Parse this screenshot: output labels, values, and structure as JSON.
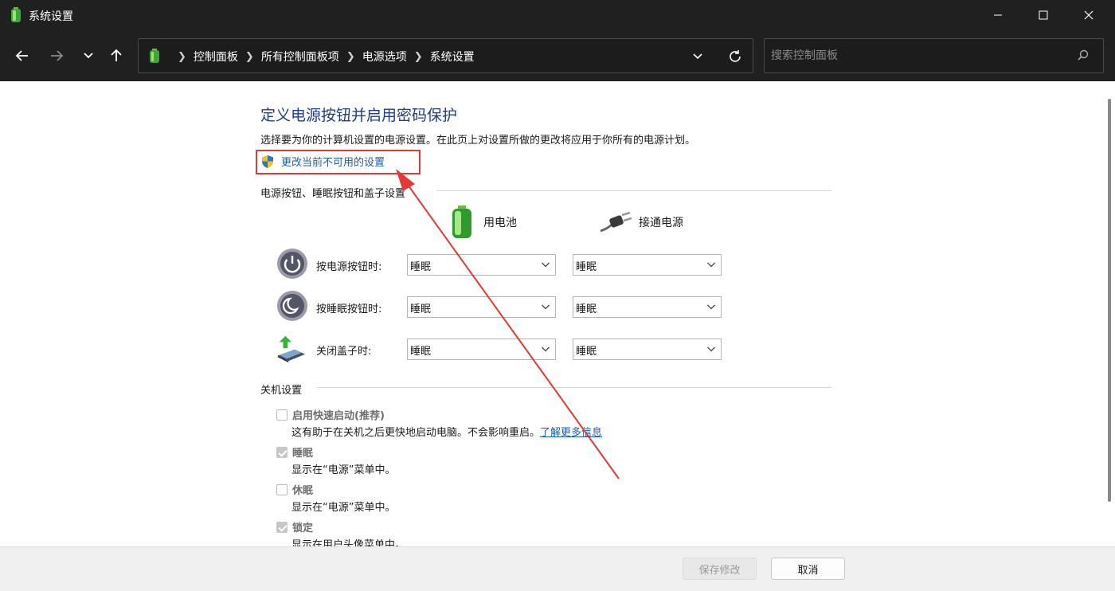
{
  "window": {
    "title": "系统设置"
  },
  "address": {
    "crumbs": [
      "控制面板",
      "所有控制面板项",
      "电源选项",
      "系统设置"
    ]
  },
  "search": {
    "placeholder": "搜索控制面板"
  },
  "page": {
    "heading": "定义电源按钮并启用密码保护",
    "description": "选择要为你的计算机设置的电源设置。在此页上对设置所做的更改将应用于你所有的电源计划。",
    "change_link": "更改当前不可用的设置"
  },
  "power_section": {
    "title": "电源按钮、睡眠按钮和盖子设置",
    "columns": [
      "用电池",
      "接通电源"
    ],
    "rows": [
      {
        "label": "按电源按钮时:",
        "icon": "power-button-icon",
        "battery": "睡眠",
        "plugged": "睡眠"
      },
      {
        "label": "按睡眠按钮时:",
        "icon": "sleep-button-icon",
        "battery": "睡眠",
        "plugged": "睡眠"
      },
      {
        "label": "关闭盖子时:",
        "icon": "laptop-lid-icon",
        "battery": "睡眠",
        "plugged": "睡眠"
      }
    ]
  },
  "shutdown_section": {
    "title": "关机设置",
    "items": [
      {
        "label": "启用快速启动(推荐)",
        "checked": false,
        "desc": "这有助于在关机之后更快地启动电脑。不会影响重启。",
        "link": "了解更多信息"
      },
      {
        "label": "睡眠",
        "checked": true,
        "desc": "显示在“电源”菜单中。"
      },
      {
        "label": "休眠",
        "checked": false,
        "desc": "显示在“电源”菜单中。"
      },
      {
        "label": "锁定",
        "checked": true,
        "desc": "显示在用户头像菜单中。"
      }
    ]
  },
  "footer": {
    "save": "保存修改",
    "cancel": "取消"
  },
  "colors": {
    "heading": "#1e3c8c",
    "link": "#1a5fb4",
    "highlight": "#e53935",
    "titlebar": "#202020"
  }
}
